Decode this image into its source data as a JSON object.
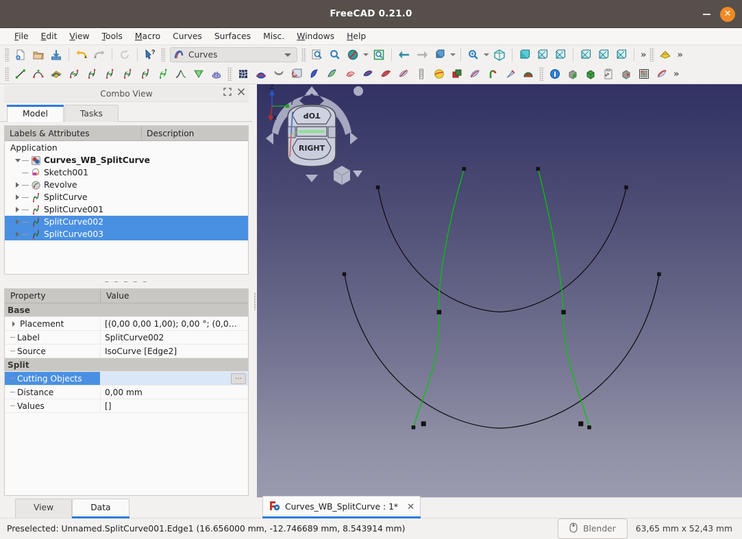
{
  "window": {
    "title": "FreeCAD 0.21.0",
    "minimize_label": "–",
    "close_label": "✕"
  },
  "menubar": {
    "items": [
      {
        "label": "File",
        "accel": "F"
      },
      {
        "label": "Edit",
        "accel": "E"
      },
      {
        "label": "View",
        "accel": "V"
      },
      {
        "label": "Tools",
        "accel": "T"
      },
      {
        "label": "Macro",
        "accel": "M"
      },
      {
        "label": "Curves",
        "accel": ""
      },
      {
        "label": "Surfaces",
        "accel": ""
      },
      {
        "label": "Misc.",
        "accel": ""
      },
      {
        "label": "Windows",
        "accel": "W"
      },
      {
        "label": "Help",
        "accel": "H"
      }
    ]
  },
  "toolbar": {
    "workbench_selector": {
      "value": "Curves",
      "icon": "curves-workbench-icon"
    },
    "overflow_label": "»",
    "row1_icons": [
      "new-document-icon",
      "open-document-icon",
      "save-document-icon",
      "undo-icon",
      "redo-icon",
      "refresh-icon",
      "whats-this-icon"
    ],
    "row1b_icons": [
      "std-view-fit-selection-icon",
      "zoom-icon",
      "draw-style-icon",
      "std-view-box-zoom-icon",
      "previous-view-icon",
      "next-view-icon",
      "axonometric-view-icon",
      "zoom-fit-icon",
      "view-isometric-icon",
      "view-front-icon",
      "view-top-icon",
      "view-right-icon",
      "view-rear-icon",
      "view-bottom-icon",
      "view-left-icon"
    ],
    "row2_icons": [
      "line-icon",
      "bspline-icon",
      "editable-spline-icon",
      "join-curve-icon",
      "split-curve-icon",
      "discretize-icon",
      "approximate-icon",
      "interpolate-icon",
      "parametric-curve-icon",
      "blend-curve-icon",
      "comb-plot-icon",
      "zebra-icon",
      "gordon-surface-icon",
      "sweep-surface-icon",
      "loft-surface-icon",
      "pipeshell-icon",
      "segment-surface-icon",
      "flatten-face-icon",
      "profile-support-icon",
      "isocurve-icon",
      "sketch-on-surface-icon",
      "multi-loft-icon",
      "solid-icon",
      "info-icon",
      "box-element-icon",
      "green-box-icon",
      "clipboard-icon",
      "reverse-icon",
      "grid-icon",
      "mixed-curve-icon"
    ]
  },
  "combo_view": {
    "panel_title": "Combo View",
    "float_icon": "restore-icon",
    "close_icon": "close-icon",
    "tabs": [
      {
        "label": "Model",
        "active": true
      },
      {
        "label": "Tasks",
        "active": false
      }
    ],
    "tree": {
      "headers": [
        "Labels & Attributes",
        "Description"
      ],
      "rows": [
        {
          "label": "Application",
          "depth": 0,
          "arrow": "none",
          "icon": "",
          "bold": false,
          "selected": false
        },
        {
          "label": "Curves_WB_SplitCurve",
          "depth": 1,
          "arrow": "down",
          "icon": "document-icon",
          "bold": true,
          "selected": false
        },
        {
          "label": "Sketch001",
          "depth": 2,
          "arrow": "none",
          "icon": "sketch-icon",
          "bold": false,
          "selected": false
        },
        {
          "label": "Revolve",
          "depth": 2,
          "arrow": "right",
          "icon": "revolve-icon",
          "bold": false,
          "selected": false
        },
        {
          "label": "SplitCurve",
          "depth": 2,
          "arrow": "right",
          "icon": "split-curve-icon",
          "bold": false,
          "selected": false
        },
        {
          "label": "SplitCurve001",
          "depth": 2,
          "arrow": "right",
          "icon": "split-curve-icon",
          "bold": false,
          "selected": false
        },
        {
          "label": "SplitCurve002",
          "depth": 2,
          "arrow": "right",
          "icon": "split-curve-icon",
          "bold": false,
          "selected": true
        },
        {
          "label": "SplitCurve003",
          "depth": 2,
          "arrow": "right",
          "icon": "split-curve-icon",
          "bold": false,
          "selected": true
        }
      ]
    },
    "separator_dashes": "– – – – –",
    "properties": {
      "headers": [
        "Property",
        "Value"
      ],
      "rows": [
        {
          "kind": "group",
          "name": "Base",
          "value": ""
        },
        {
          "kind": "item",
          "name": "Placement",
          "value": "[(0,00 0,00 1,00); 0,00 °; (0,0…",
          "expandable": true
        },
        {
          "kind": "item",
          "name": "Label",
          "value": "SplitCurve002",
          "expandable": false
        },
        {
          "kind": "item",
          "name": "Source",
          "value": "IsoCurve [Edge2]",
          "expandable": false
        },
        {
          "kind": "group",
          "name": "Split",
          "value": ""
        },
        {
          "kind": "item",
          "name": "Cutting Objects",
          "value": "",
          "expandable": false,
          "selected": true,
          "has_button": true,
          "button_label": "…"
        },
        {
          "kind": "item",
          "name": "Distance",
          "value": "0,00 mm",
          "expandable": false
        },
        {
          "kind": "item",
          "name": "Values",
          "value": "[]",
          "expandable": false
        }
      ]
    },
    "bottom_tabs": [
      {
        "label": "View",
        "active": false
      },
      {
        "label": "Data",
        "active": true
      }
    ]
  },
  "viewport": {
    "nav_cube": {
      "top_face_label": "TOP",
      "front_face_label": "RIGHT",
      "home_icon": "home-dot-icon",
      "corner_cube_icon": "view-cube-icon"
    },
    "axis_indicator": {
      "x": "X",
      "y": "Y",
      "z": "Z"
    },
    "colors": {
      "curve_selected": "#00c000",
      "curve_default": "#000000",
      "bg_top": "#313163",
      "bg_bottom": "#9b9bb0"
    }
  },
  "document_tab": {
    "label": "Curves_WB_SplitCurve : 1*",
    "icon": "freecad-document-icon",
    "close_label": "✕"
  },
  "statusbar": {
    "message": "Preselected: Unnamed.SplitCurve001.Edge1 (16.656000 mm, -12.746689 mm, 8.543914 mm)",
    "nav_style": {
      "label": "Blender",
      "icon": "mouse-icon"
    },
    "dimensions": "63,65 mm x 52,43 mm"
  }
}
